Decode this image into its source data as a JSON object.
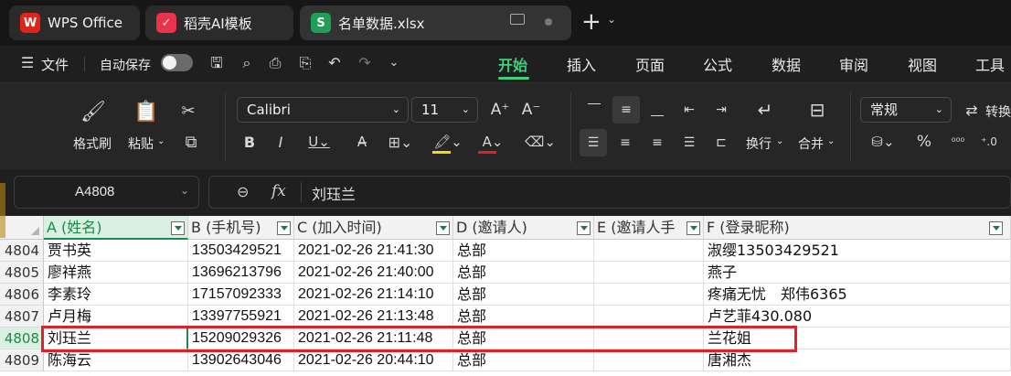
{
  "tabs": [
    {
      "label": "WPS Office"
    },
    {
      "label": "稻壳AI模板"
    },
    {
      "label": "名单数据.xlsx"
    }
  ],
  "menu": {
    "file_label": "文件",
    "autosave_label": "自动保存",
    "items": [
      "开始",
      "插入",
      "页面",
      "公式",
      "数据",
      "审阅",
      "视图",
      "工具"
    ]
  },
  "ribbon": {
    "format_painter": "格式刷",
    "paste": "粘贴",
    "font_name": "Calibri",
    "font_size": "11",
    "wrap": "换行",
    "merge": "合并",
    "number_format": "常规",
    "convert": "转换"
  },
  "formula_bar": {
    "name_box": "A4808",
    "fx": "fx",
    "content": "刘珏兰"
  },
  "grid": {
    "columns": [
      {
        "label": "A (姓名)"
      },
      {
        "label": "B (手机号)"
      },
      {
        "label": "C (加入时间)"
      },
      {
        "label": "D (邀请人)"
      },
      {
        "label": "E (邀请人手"
      },
      {
        "label": "F (登录昵称)"
      }
    ],
    "rows": [
      {
        "num": "4804",
        "cells": [
          "贾书英",
          "13503429521",
          "2021-02-26 21:41:30",
          "总部",
          "",
          "淑缨13503429521"
        ]
      },
      {
        "num": "4805",
        "cells": [
          "廖祥燕",
          "13696213796",
          "2021-02-26 21:40:00",
          "总部",
          "",
          "燕子"
        ]
      },
      {
        "num": "4806",
        "cells": [
          "李素玲",
          "17157092333",
          "2021-02-26 21:14:10",
          "总部",
          "",
          "疼痛无忧　郑伟6365"
        ]
      },
      {
        "num": "4807",
        "cells": [
          "卢月梅",
          "13397755921",
          "2021-02-26 21:13:48",
          "总部",
          "",
          "卢艺菲430.080"
        ]
      },
      {
        "num": "4808",
        "cells": [
          "刘珏兰",
          "15209029326",
          "2021-02-26 21:11:48",
          "总部",
          "",
          "兰花姐"
        ]
      },
      {
        "num": "4809",
        "cells": [
          "陈海云",
          "13902643046",
          "2021-02-26 20:44:10",
          "总部",
          "",
          "唐湘杰"
        ]
      }
    ]
  },
  "colors": {
    "accent": "#1e8a4a",
    "highlight_box": "#e0202a",
    "wps_red": "#e2231a",
    "sheet_green": "#1f9e55"
  }
}
